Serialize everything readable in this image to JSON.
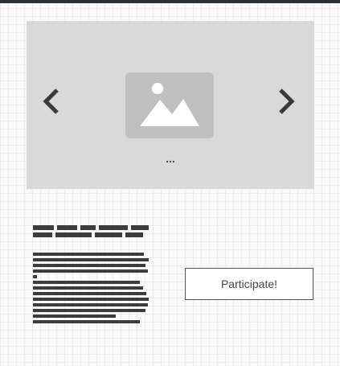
{
  "carousel": {
    "prev_icon": "chevron-left-icon",
    "next_icon": "chevron-right-icon",
    "image_icon": "image-placeholder-icon",
    "pager_text": "..."
  },
  "cta": {
    "label": "Participate!"
  },
  "colors": {
    "topbar": "#2b2f38",
    "carousel_bg": "#d9d9d9",
    "placeholder": "#bfbfbf",
    "ink": "#3c3c3c"
  }
}
